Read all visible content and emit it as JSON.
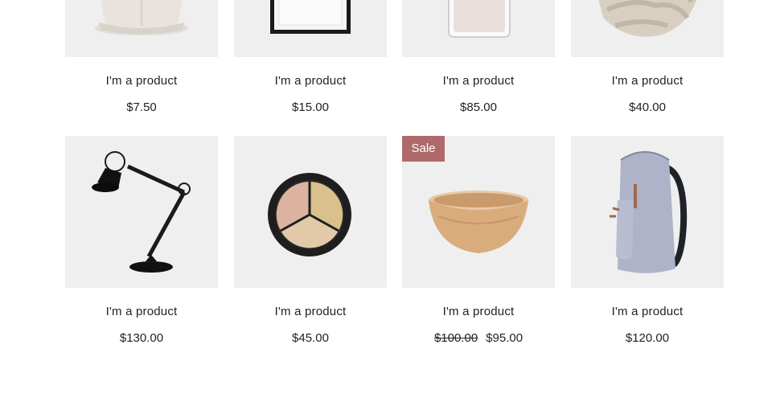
{
  "products": [
    {
      "name": "I'm a product",
      "price": "$7.50",
      "image": "vase"
    },
    {
      "name": "I'm a product",
      "price": "$15.00",
      "image": "frame"
    },
    {
      "name": "I'm a product",
      "price": "$85.00",
      "image": "perfume-bottle"
    },
    {
      "name": "I'm a product",
      "price": "$40.00",
      "image": "knit-scarf"
    },
    {
      "name": "I'm a product",
      "price": "$130.00",
      "image": "desk-lamp"
    },
    {
      "name": "I'm a product",
      "price": "$45.00",
      "image": "makeup-palette"
    },
    {
      "name": "I'm a product",
      "price": "$95.00",
      "old_price": "$100.00",
      "badge": "Sale",
      "image": "wooden-bowl"
    },
    {
      "name": "I'm a product",
      "price": "$120.00",
      "image": "backpack"
    }
  ],
  "colors": {
    "badge": "#b0696b",
    "thumb_background": "#efefef",
    "text": "#222222"
  }
}
